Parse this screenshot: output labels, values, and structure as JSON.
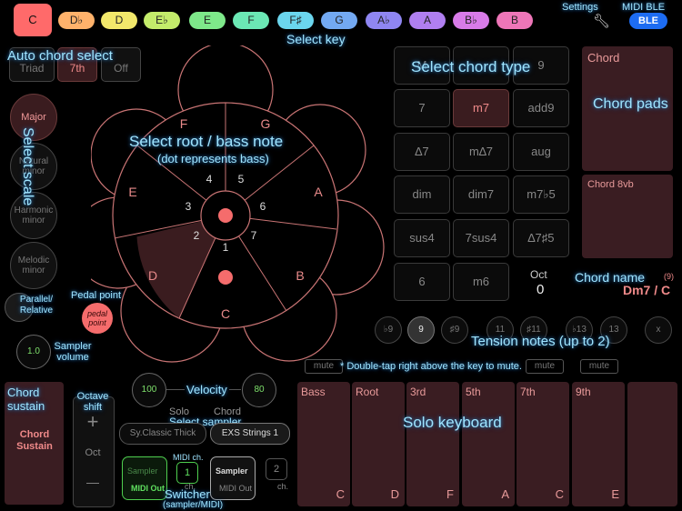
{
  "keys": {
    "items": [
      "C",
      "D♭",
      "D",
      "E♭",
      "E",
      "F",
      "F♯",
      "G",
      "A♭",
      "A",
      "B♭",
      "B"
    ],
    "colors": [
      "#ff6a6a",
      "#ffb26b",
      "#f2e86b",
      "#c4ec6b",
      "#7ee88a",
      "#6be8b4",
      "#6bd6ee",
      "#73a9f2",
      "#8f86f2",
      "#b07ff0",
      "#d87be8",
      "#ee76b8"
    ]
  },
  "settings": {
    "label": "Settings",
    "midi_label": "MIDI BLE",
    "ble": "BLE"
  },
  "chord_select": {
    "triad": "Triad",
    "seventh": "7th",
    "off": "Off"
  },
  "scales": [
    {
      "label": "Major"
    },
    {
      "label": "Natural minor"
    },
    {
      "label": "Harmonic minor"
    },
    {
      "label": "Melodic minor"
    }
  ],
  "parallel": "Parallel/ Relative",
  "pedal": {
    "title": "Pedal point",
    "button": "pedal point"
  },
  "sampler_volume": {
    "value": "1.0",
    "label": "Sampler volume"
  },
  "wheel": {
    "notes": [
      "C",
      "D",
      "E",
      "F",
      "G",
      "A",
      "B"
    ],
    "degrees": [
      "1",
      "2",
      "3",
      "4",
      "5",
      "6",
      "7"
    ]
  },
  "chord_types": {
    "rows": [
      [
        "M",
        "",
        "9"
      ],
      [
        "7",
        "m7",
        "add9"
      ],
      [
        "∆7",
        "m∆7",
        "aug"
      ],
      [
        "dim",
        "dim7",
        "m7♭5"
      ],
      [
        "sus4",
        "7sus4",
        "∆7♯5"
      ],
      [
        "6",
        "m6",
        ""
      ]
    ]
  },
  "chord_pads": {
    "top": "Chord",
    "bottom": "Chord 8vb"
  },
  "octave": {
    "label": "Oct",
    "value": "0"
  },
  "chord_name": {
    "badge": "(9)",
    "value": "Dm7 / C"
  },
  "tensions": [
    "♭9",
    "9",
    "♯9",
    "11",
    "♯11",
    "♭13",
    "13",
    "x"
  ],
  "mute": {
    "label": "mute",
    "hint": "* Double-tap right above the key to mute."
  },
  "solo_keys": [
    {
      "label": "Bass",
      "note": "C"
    },
    {
      "label": "Root",
      "note": "D"
    },
    {
      "label": "3rd",
      "note": "F"
    },
    {
      "label": "5th",
      "note": "A"
    },
    {
      "label": "7th",
      "note": "C"
    },
    {
      "label": "9th",
      "note": "E"
    },
    {
      "label": "",
      "note": ""
    }
  ],
  "chord_sustain": {
    "title": "Chord sustain",
    "button": "Chord Sustain"
  },
  "octave_shift": {
    "title": "Octave shift",
    "plus": "+",
    "label": "Oct",
    "minus": "—"
  },
  "velocity": {
    "solo": "100",
    "chord": "80",
    "label": "Velocity"
  },
  "sampler": {
    "solo_title": "Solo",
    "chord_title": "Chord",
    "solo_instrument": "Sy.Classic Thick",
    "chord_instrument": "EXS Strings 1",
    "sampler_label": "Sampler",
    "midi_out": "MIDI Out",
    "midi_ch_label": "MIDI ch.",
    "solo_ch": "1",
    "chord_ch": "2",
    "ch": "ch."
  },
  "annotations": {
    "auto_chord": "Auto chord select",
    "select_key": "Select key",
    "select_chord_type": "Select chord type",
    "chord_pads": "Chord pads",
    "select_root": "Select root / bass note",
    "select_root_sub": "(dot represents bass)",
    "select_scale": "Select scale",
    "chord_name": "Chord name",
    "tension": "Tension notes (up to 2)",
    "solo_keyboard": "Solo keyboard",
    "select_sampler": "Select sampler",
    "switcher": "Switcher",
    "switcher_sub": "(sampler/MIDI)"
  }
}
